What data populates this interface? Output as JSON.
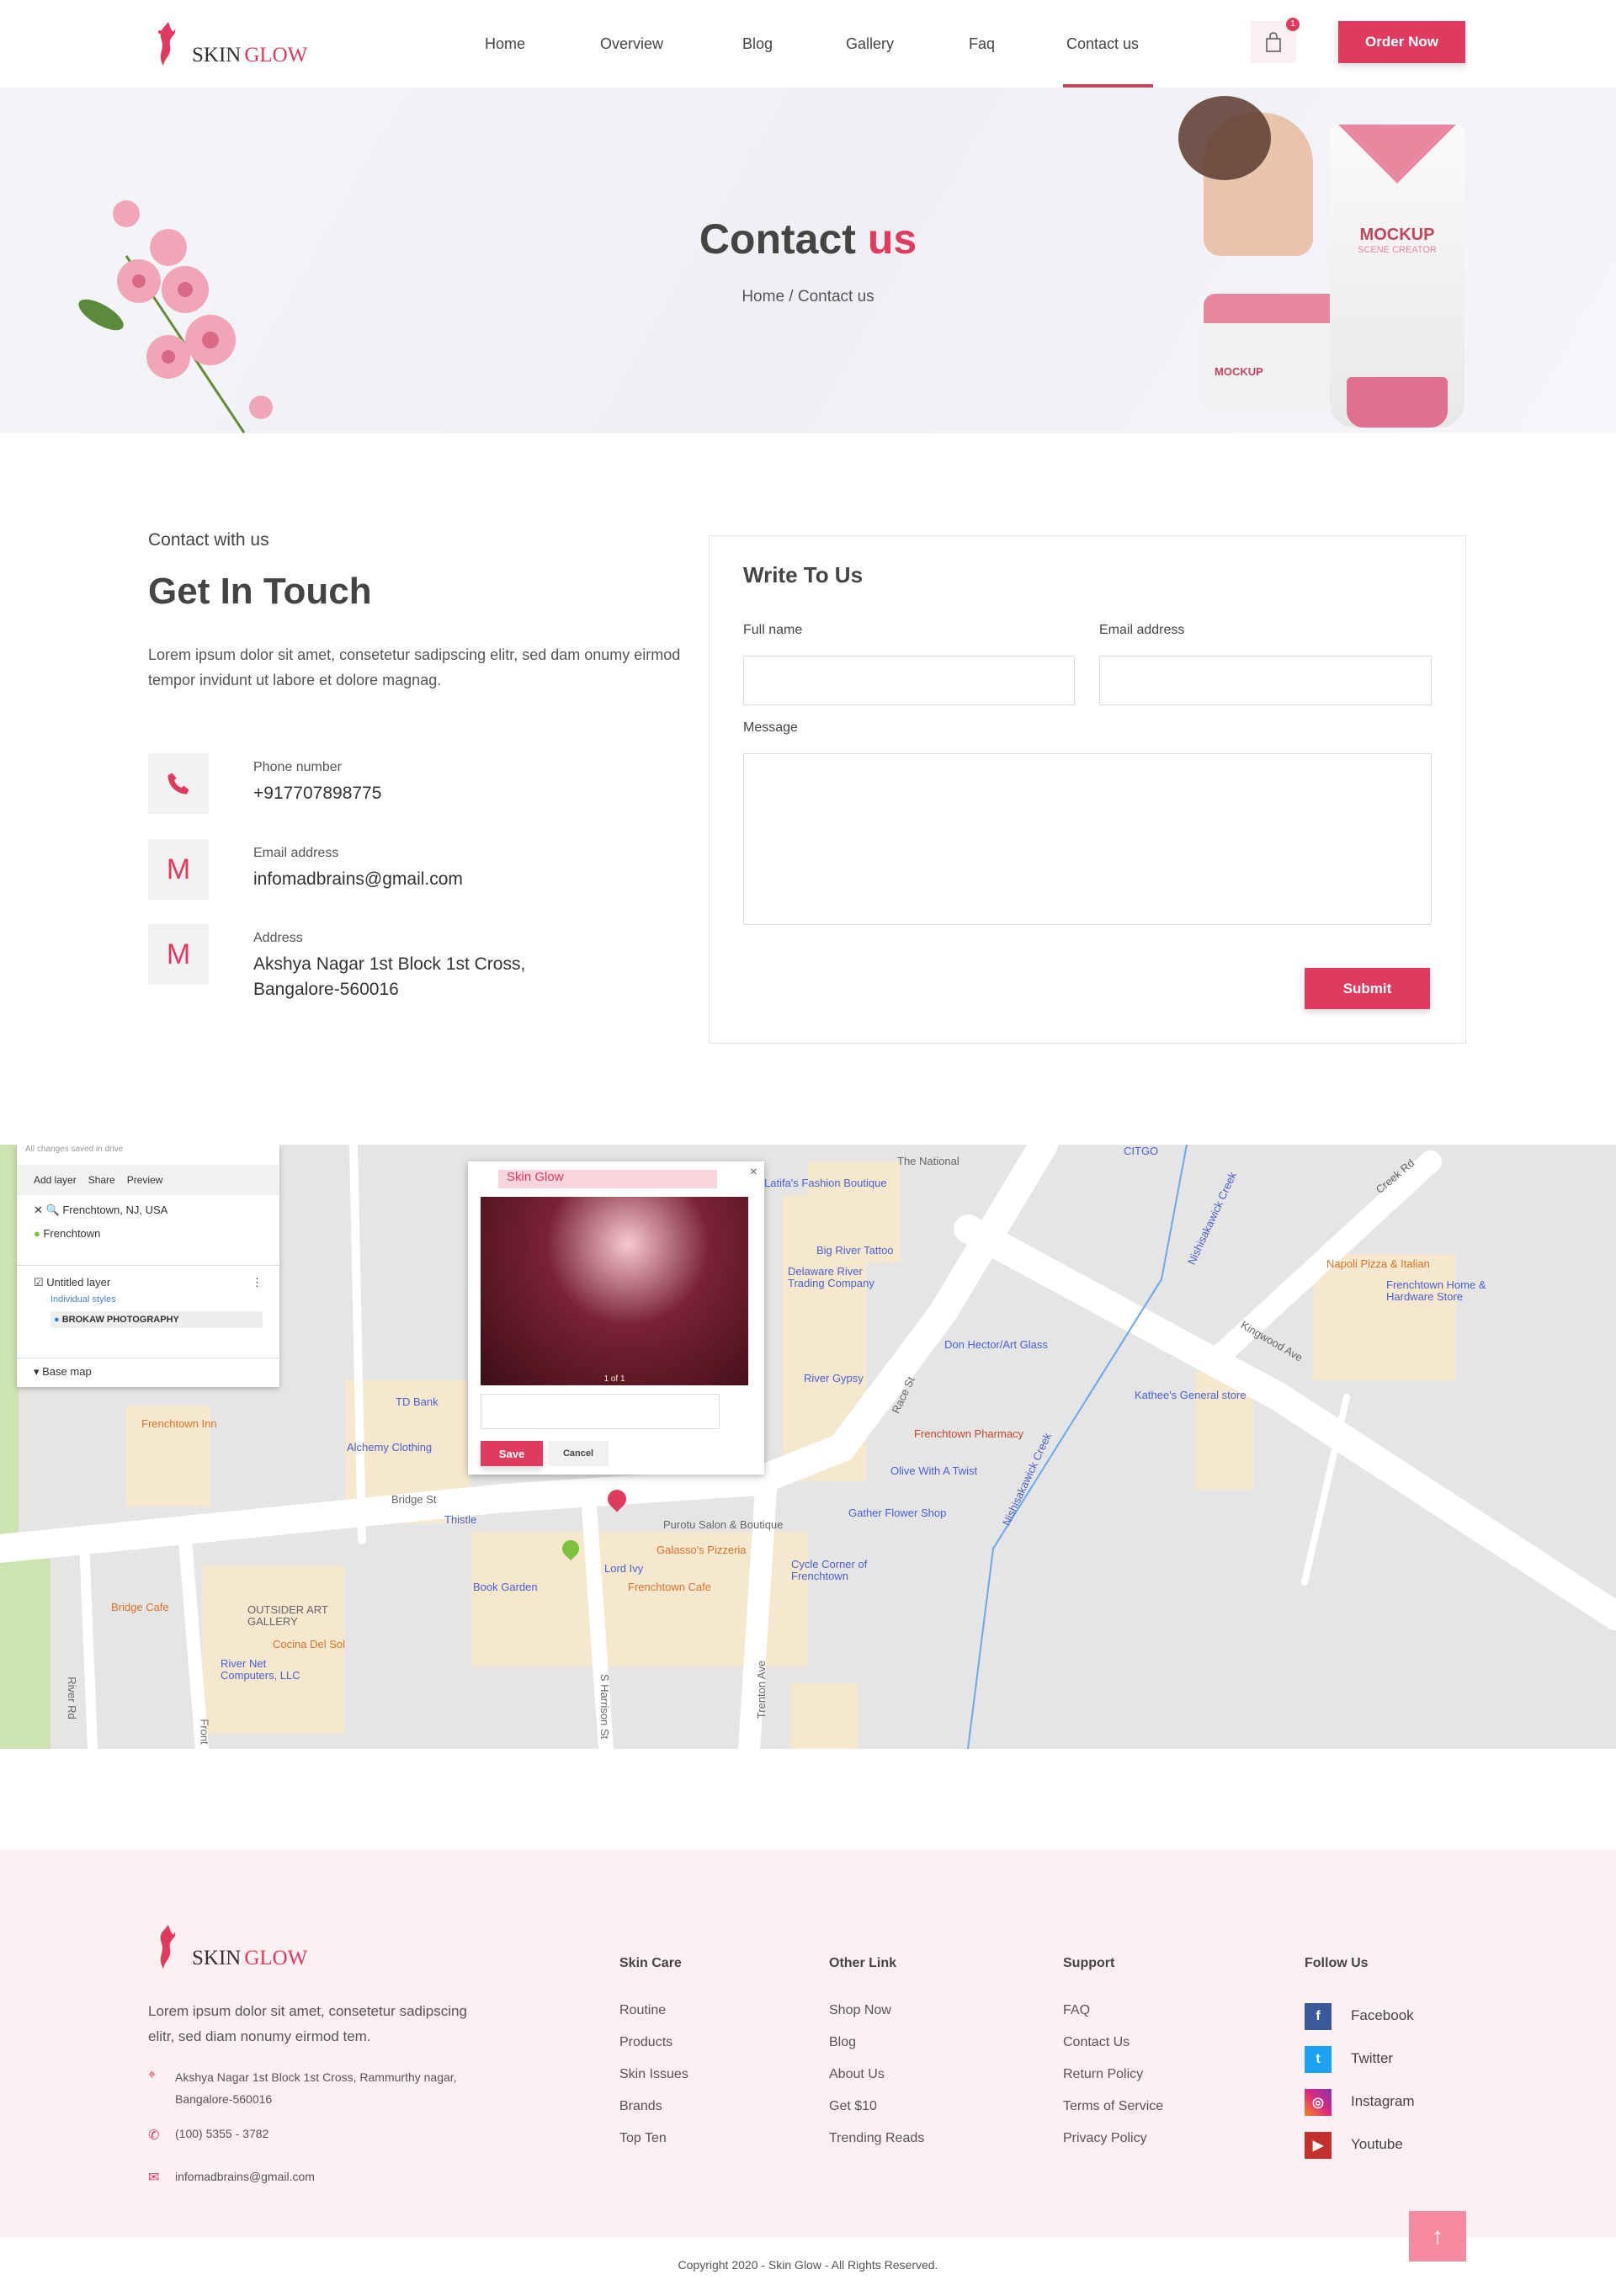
{
  "brand": {
    "name_a": "SKIN",
    "name_b": "GLOW"
  },
  "nav": {
    "items": [
      "Home",
      "Overview",
      "Blog",
      "Gallery",
      "Faq",
      "Contact us"
    ],
    "active": "Contact us",
    "cart_count": "1",
    "order_button": "Order Now"
  },
  "hero": {
    "title_a": "Contact",
    "title_b": "us",
    "breadcrumb": "Home / Contact us",
    "product_label": "MOCKUP",
    "product_sub": "SCENE CREATOR"
  },
  "contact": {
    "eyebrow": "Contact with us",
    "heading": "Get In Touch",
    "intro": "Lorem ipsum dolor sit amet, consetetur sadipscing elitr, sed dam onumy eirmod tempor invidunt ut labore et dolore magnag.",
    "items": [
      {
        "label": "Phone number",
        "value": "+917707898775",
        "icon": "phone-icon"
      },
      {
        "label": "Email address",
        "value": "infomadbrains@gmail.com",
        "icon": "mail-icon"
      },
      {
        "label": "Address",
        "value": "Akshya Nagar 1st Block 1st Cross, Bangalore-560016",
        "icon": "mail-icon"
      }
    ]
  },
  "form": {
    "title": "Write To Us",
    "full_name_label": "Full name",
    "email_label": "Email address",
    "message_label": "Message",
    "full_name": "",
    "email": "",
    "message": "",
    "submit": "Submit"
  },
  "map": {
    "panel": {
      "saved": "All changes saved in drive",
      "add_layer": "Add layer",
      "share": "Share",
      "preview": "Preview",
      "search": "Frenchtown, NJ, USA",
      "place": "Frenchtown",
      "layer": "Untitled layer",
      "styles": "Individual styles",
      "item": "BROKAW PHOTOGRAPHY",
      "base_map": "Base map"
    },
    "popup": {
      "title": "Skin Glow",
      "counter": "1 of 1",
      "save": "Save",
      "cancel": "Cancel"
    },
    "labels": [
      "CITGO",
      "The National",
      "Latifa's Fashion Boutique",
      "Big River Tattoo",
      "Delaware River Trading Company",
      "Don Hector/Art Glass",
      "River Gypsy",
      "Race St",
      "Frenchtown Pharmacy",
      "Olive With A Twist",
      "Gather Flower Shop",
      "Cycle Corner of Frenchtown",
      "Kathee's General store",
      "Napoli Pizza & Italian",
      "Frenchtown Home & Hardware Store",
      "Kingwood Ave",
      "Creek Rd",
      "Nishisakawick Creek",
      "Nishisakawick Creek",
      "Trenton Ave",
      "TD Bank",
      "Alchemy Clothing",
      "Frenchtown Inn",
      "Bridge St",
      "Thistle",
      "Purotu Salon & Boutique",
      "Galasso's Pizzeria",
      "Lord Ivy",
      "Frenchtown Cafe",
      "Book Garden",
      "Bridge Cafe",
      "OUTSIDER ART GALLERY",
      "Cocina Del Sol",
      "River Net Computers, LLC",
      "S Harrison St",
      "River Rd",
      "Front"
    ]
  },
  "footer": {
    "about": "Lorem ipsum dolor sit amet, consetetur sadipscing elitr, sed diam nonumy eirmod tem.",
    "address": "Akshya Nagar 1st Block 1st Cross, Rammurthy nagar, Bangalore-560016",
    "phone": "(100) 5355 - 3782",
    "email": "infomadbrains@gmail.com",
    "columns": [
      {
        "title": "Skin Care",
        "links": [
          "Routine",
          "Products",
          "Skin Issues",
          "Brands",
          "Top Ten"
        ]
      },
      {
        "title": "Other Link",
        "links": [
          "Shop Now",
          "Blog",
          "About Us",
          "Get $10",
          "Trending Reads"
        ]
      },
      {
        "title": "Support",
        "links": [
          "FAQ",
          "Contact Us",
          "Return Policy",
          "Terms of Service",
          "Privacy Policy"
        ]
      }
    ],
    "follow": {
      "title": "Follow Us",
      "items": [
        {
          "label": "Facebook",
          "color": "#3b5998"
        },
        {
          "label": "Twitter",
          "color": "#1da1f2"
        },
        {
          "label": "Instagram",
          "color": "#e1306c"
        },
        {
          "label": "Youtube",
          "color": "#c4302b"
        }
      ]
    },
    "copyright": "Copyright 2020 - Skin Glow - All Rights Reserved."
  }
}
